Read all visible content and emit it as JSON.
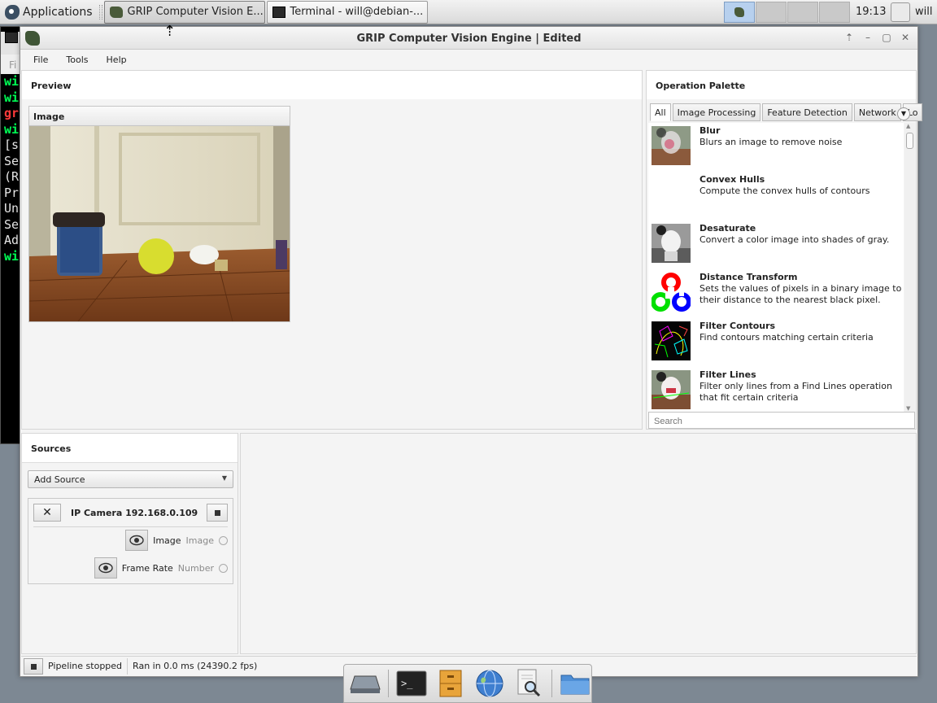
{
  "taskbar": {
    "applications_label": "Applications",
    "tasks": [
      {
        "label": "GRIP Computer Vision E...",
        "active": true
      },
      {
        "label": "Terminal - will@debian-...",
        "active": false
      }
    ],
    "clock": "19:13",
    "user": "will"
  },
  "terminal": {
    "menu_label": "Fi",
    "lines": [
      {
        "text": "wi",
        "color": "#00ff55"
      },
      {
        "text": "wi",
        "color": "#00ff55"
      },
      {
        "text": "gr",
        "color": "#ff3b3b"
      },
      {
        "text": "wi",
        "color": "#00ff55"
      },
      {
        "text": "[s",
        "color": "#e8e8e8"
      },
      {
        "text": "Se",
        "color": "#e8e8e8"
      },
      {
        "text": "(R",
        "color": "#e8e8e8"
      },
      {
        "text": "Pr",
        "color": "#e8e8e8"
      },
      {
        "text": "Un",
        "color": "#e8e8e8"
      },
      {
        "text": "Se",
        "color": "#e8e8e8"
      },
      {
        "text": "Ad",
        "color": "#e8e8e8"
      },
      {
        "text": "wi",
        "color": "#00ff55"
      }
    ]
  },
  "window": {
    "title": "GRIP Computer Vision Engine | Edited",
    "controls": [
      "⇡",
      "–",
      "▢",
      "✕"
    ],
    "menu": [
      "File",
      "Tools",
      "Help"
    ]
  },
  "preview": {
    "header": "Preview",
    "card_title": "Image"
  },
  "palette": {
    "header": "Operation Palette",
    "tabs": [
      "All",
      "Image Processing",
      "Feature Detection",
      "Network",
      "Lo"
    ],
    "operations": [
      {
        "name": "Blur",
        "desc": "Blurs an image to remove noise",
        "thumb": "blur"
      },
      {
        "name": "Convex Hulls",
        "desc": "Compute the convex hulls of contours",
        "thumb": "none"
      },
      {
        "name": "Desaturate",
        "desc": "Convert a color image into shades of gray.",
        "thumb": "gray"
      },
      {
        "name": "Distance Transform",
        "desc": "Sets the values of pixels in a binary image to their distance to the nearest black pixel.",
        "thumb": "opencv"
      },
      {
        "name": "Filter Contours",
        "desc": "Find contours matching certain criteria",
        "thumb": "contours"
      },
      {
        "name": "Filter Lines",
        "desc": "Filter only lines from a Find Lines operation that fit certain criteria",
        "thumb": "lines"
      }
    ],
    "search_placeholder": "Search"
  },
  "sources": {
    "header": "Sources",
    "add_source": "Add Source",
    "camera_name": "IP Camera 192.168.0.109",
    "sockets": [
      {
        "label": "Image",
        "type": "Image"
      },
      {
        "label": "Frame Rate",
        "type": "Number"
      }
    ]
  },
  "status": {
    "pipeline": "Pipeline stopped",
    "timing": "Ran in 0.0 ms (24390.2 fps)"
  },
  "dock": {
    "items": [
      "drive-icon",
      "terminal-icon",
      "file-cabinet-icon",
      "globe-icon",
      "search-document-icon",
      "folder-icon"
    ]
  }
}
